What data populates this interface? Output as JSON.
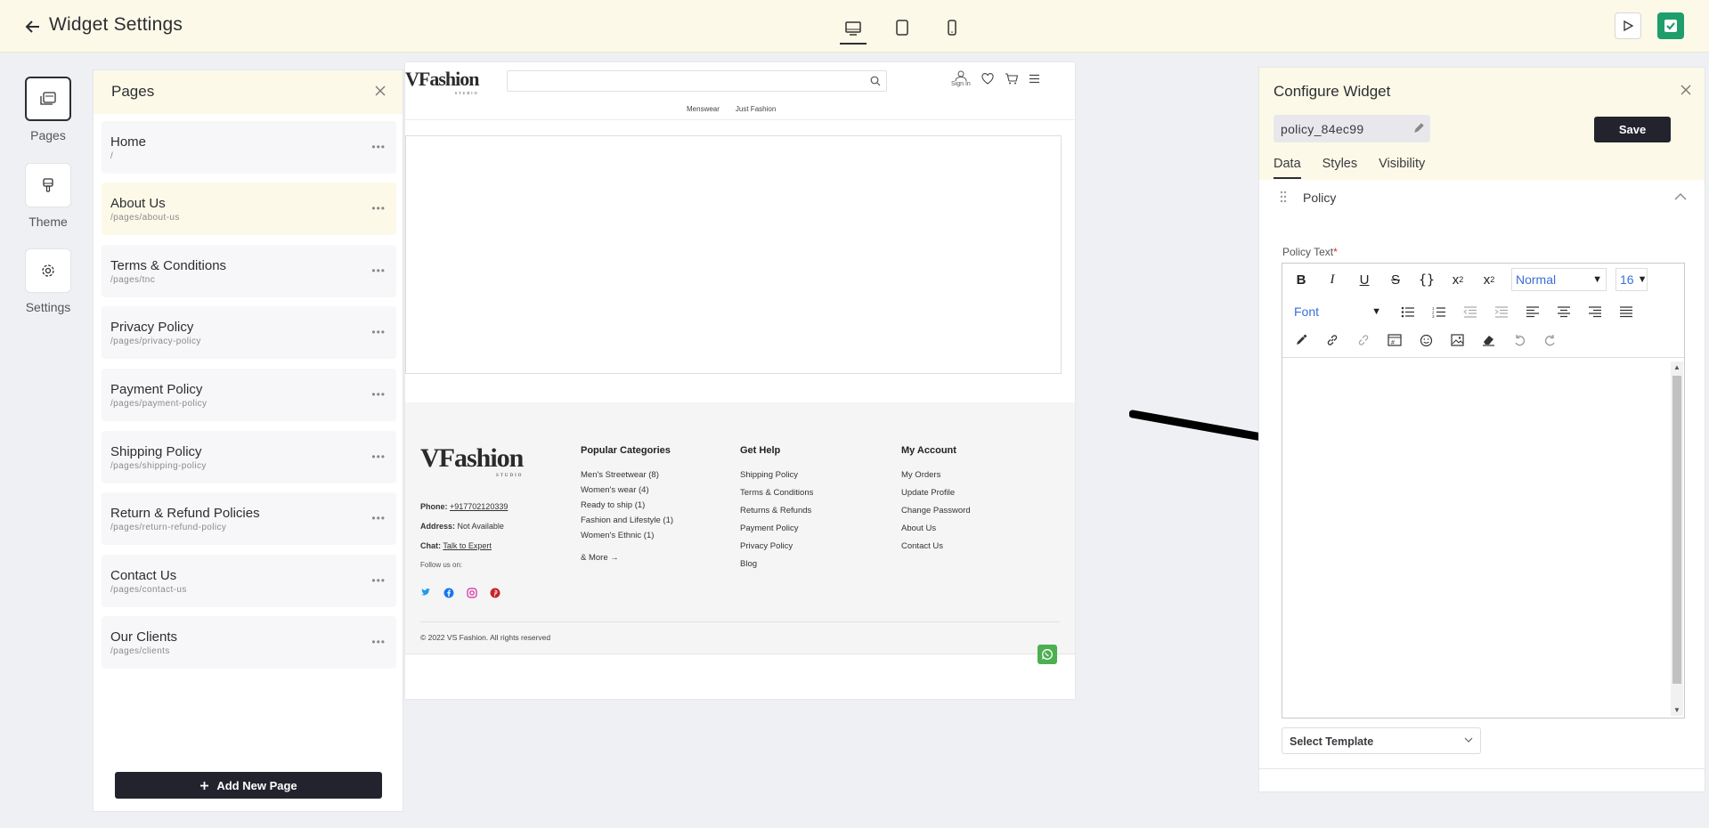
{
  "header": {
    "title": "Widget Settings",
    "devices": [
      "desktop-icon",
      "tablet-icon",
      "mobile-icon"
    ]
  },
  "rail": {
    "items": [
      {
        "label": "Pages",
        "icon": "pages-icon"
      },
      {
        "label": "Theme",
        "icon": "theme-icon"
      },
      {
        "label": "Settings",
        "icon": "gear-icon"
      }
    ]
  },
  "pages_panel": {
    "title": "Pages",
    "add_label": "Add New Page",
    "items": [
      {
        "name": "Home",
        "path": "/"
      },
      {
        "name": "About Us",
        "path": "/pages/about-us"
      },
      {
        "name": "Terms & Conditions",
        "path": "/pages/tnc"
      },
      {
        "name": "Privacy Policy",
        "path": "/pages/privacy-policy"
      },
      {
        "name": "Payment Policy",
        "path": "/pages/payment-policy"
      },
      {
        "name": "Shipping Policy",
        "path": "/pages/shipping-policy"
      },
      {
        "name": "Return & Refund Policies",
        "path": "/pages/return-refund-policy"
      },
      {
        "name": "Contact Us",
        "path": "/pages/contact-us"
      },
      {
        "name": "Our Clients",
        "path": "/pages/clients"
      }
    ]
  },
  "preview": {
    "logo": "VFashion",
    "logo_sub": "STUDIO",
    "signin": "Sign In",
    "nav": [
      "Menswear",
      "Just Fashion"
    ],
    "footer": {
      "phone_label": "Phone:",
      "phone": "+917702120339",
      "address_label": "Address:",
      "address": "Not Available",
      "chat_label": "Chat:",
      "chat": "Talk to Expert",
      "follow": "Follow us on:",
      "columns": [
        {
          "title": "Popular Categories",
          "links": [
            "Men's Streetwear (8)",
            "Women's wear (4)",
            "Ready to ship (1)",
            "Fashion and Lifestyle (1)",
            "Women's Ethnic (1)"
          ],
          "more": "& More"
        },
        {
          "title": "Get Help",
          "links": [
            "Shipping Policy",
            "Terms & Conditions",
            "Returns & Refunds",
            "Payment Policy",
            "Privacy Policy",
            "Blog"
          ]
        },
        {
          "title": "My Account",
          "links": [
            "My Orders",
            "Update Profile",
            "Change Password",
            "About Us",
            "Contact Us"
          ]
        }
      ],
      "copyright": "© 2022 VS Fashion. All rights reserved"
    }
  },
  "config": {
    "title": "Configure Widget",
    "widget_id": "policy_84ec99",
    "save_label": "Save",
    "tabs": [
      "Data",
      "Styles",
      "Visibility"
    ],
    "section_title": "Policy",
    "field_label": "Policy Text",
    "required_mark": "*",
    "toolbar": {
      "format": "Normal",
      "size": "16",
      "font": "Font"
    },
    "template_placeholder": "Select Template"
  },
  "colors": {
    "header_bg": "#fdf9e8",
    "publish": "#1f9d6b",
    "dark_button": "#23232e",
    "link_blue": "#3a6fd8"
  }
}
